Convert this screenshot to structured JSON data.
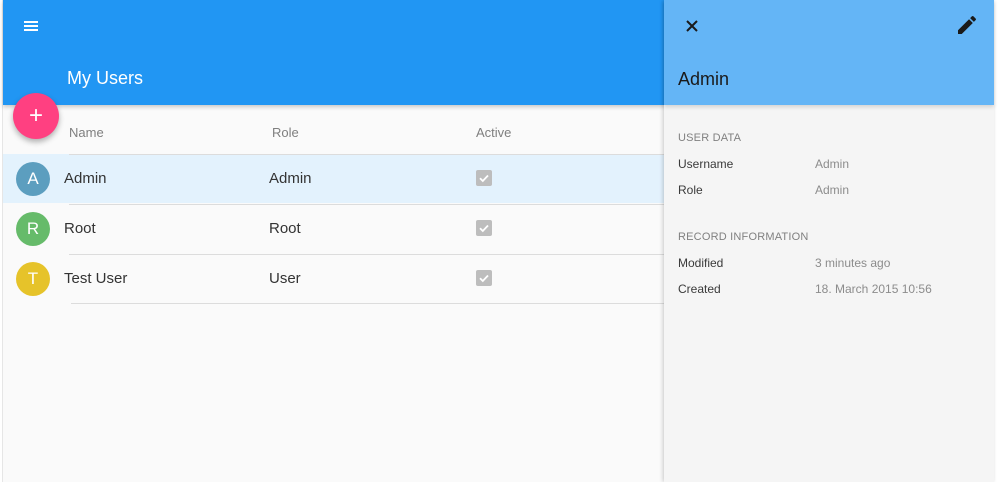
{
  "list": {
    "title": "My Users",
    "add_label": "+",
    "columns": {
      "name": "Name",
      "role": "Role",
      "active": "Active"
    },
    "rows": [
      {
        "initial": "A",
        "name": "Admin",
        "role": "Admin",
        "active": true,
        "color": "#5c9ebf",
        "selected": true
      },
      {
        "initial": "R",
        "name": "Root",
        "role": "Root",
        "active": true,
        "color": "#66bb6a",
        "selected": false
      },
      {
        "initial": "T",
        "name": "Test User",
        "role": "User",
        "active": true,
        "color": "#e6c32a",
        "selected": false
      }
    ]
  },
  "detail": {
    "title": "Admin",
    "sections": [
      {
        "title": "USER DATA",
        "fields": [
          {
            "label": "Username",
            "value": "Admin"
          },
          {
            "label": "Role",
            "value": "Admin"
          }
        ]
      },
      {
        "title": "RECORD INFORMATION",
        "fields": [
          {
            "label": "Modified",
            "value": "3 minutes ago"
          },
          {
            "label": "Created",
            "value": "18. March 2015 10:56"
          }
        ]
      }
    ]
  },
  "icons": {
    "menu": "menu-icon",
    "add": "plus-icon",
    "close": "close-icon",
    "edit": "pencil-icon",
    "check": "check-icon"
  },
  "colors": {
    "primary": "#2196f3",
    "primary_light": "#64b5f6",
    "accent": "#ff4081",
    "selected_row": "#e3f2fd"
  }
}
